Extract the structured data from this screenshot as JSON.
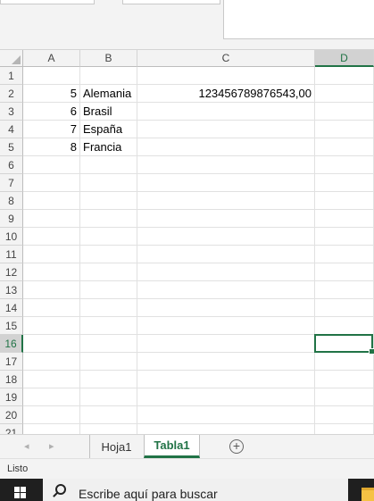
{
  "spreadsheet": {
    "columns": [
      "A",
      "B",
      "C",
      "D"
    ],
    "selected_column": "D",
    "selected_row": "16",
    "rows": [
      {
        "num": "1",
        "a": "",
        "b": "",
        "c": ""
      },
      {
        "num": "2",
        "a": "5",
        "b": "Alemania",
        "c": "123456789876543,00"
      },
      {
        "num": "3",
        "a": "6",
        "b": "Brasil",
        "c": ""
      },
      {
        "num": "4",
        "a": "7",
        "b": "España",
        "c": ""
      },
      {
        "num": "5",
        "a": "8",
        "b": "Francia",
        "c": ""
      },
      {
        "num": "6",
        "a": "",
        "b": "",
        "c": ""
      },
      {
        "num": "7",
        "a": "",
        "b": "",
        "c": ""
      },
      {
        "num": "8",
        "a": "",
        "b": "",
        "c": ""
      },
      {
        "num": "9",
        "a": "",
        "b": "",
        "c": ""
      },
      {
        "num": "10",
        "a": "",
        "b": "",
        "c": ""
      },
      {
        "num": "11",
        "a": "",
        "b": "",
        "c": ""
      },
      {
        "num": "12",
        "a": "",
        "b": "",
        "c": ""
      },
      {
        "num": "13",
        "a": "",
        "b": "",
        "c": ""
      },
      {
        "num": "14",
        "a": "",
        "b": "",
        "c": ""
      },
      {
        "num": "15",
        "a": "",
        "b": "",
        "c": ""
      },
      {
        "num": "16",
        "a": "",
        "b": "",
        "c": ""
      },
      {
        "num": "17",
        "a": "",
        "b": "",
        "c": ""
      },
      {
        "num": "18",
        "a": "",
        "b": "",
        "c": ""
      },
      {
        "num": "19",
        "a": "",
        "b": "",
        "c": ""
      },
      {
        "num": "20",
        "a": "",
        "b": "",
        "c": ""
      },
      {
        "num": "21",
        "a": "",
        "b": "",
        "c": ""
      }
    ]
  },
  "sheet_tabs": {
    "nav_prev": "◂",
    "nav_next": "▸",
    "tabs": [
      "Hoja1",
      "Tabla1"
    ],
    "active_tab": "Tabla1",
    "add_label": "+"
  },
  "status_bar": {
    "status": "Listo"
  },
  "taskbar": {
    "search_placeholder": "Escribe aquí para buscar"
  },
  "colors": {
    "accent": "#217346",
    "header_bg": "#f3f3f3",
    "taskbar_bg": "#1f1f1f"
  }
}
